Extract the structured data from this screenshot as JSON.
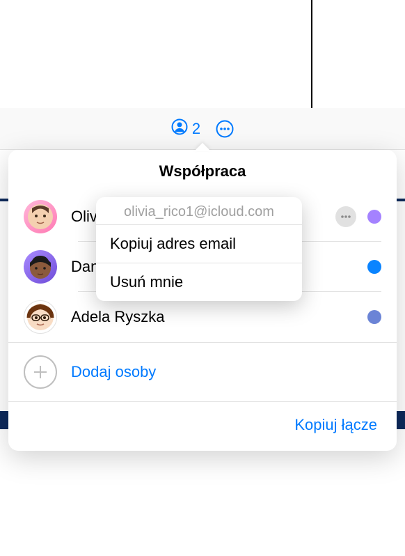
{
  "toolbar": {
    "participant_count": "2"
  },
  "sheet": {
    "title": "Współpraca"
  },
  "participants": [
    {
      "name": "Olivia Rico",
      "dot_color": "#a482ff"
    },
    {
      "name": "Daniel Ryszka (właściciel)",
      "dot_color": "#0a84ff"
    },
    {
      "name": "Adela Ryszka",
      "dot_color": "#6b84d6"
    }
  ],
  "add_people": {
    "label": "Dodaj osoby"
  },
  "copy_link": {
    "label": "Kopiuj łącze"
  },
  "context_menu": {
    "email": "olivia_rico1@icloud.com",
    "copy_email": "Kopiuj adres email",
    "remove_me": "Usuń mnie"
  }
}
